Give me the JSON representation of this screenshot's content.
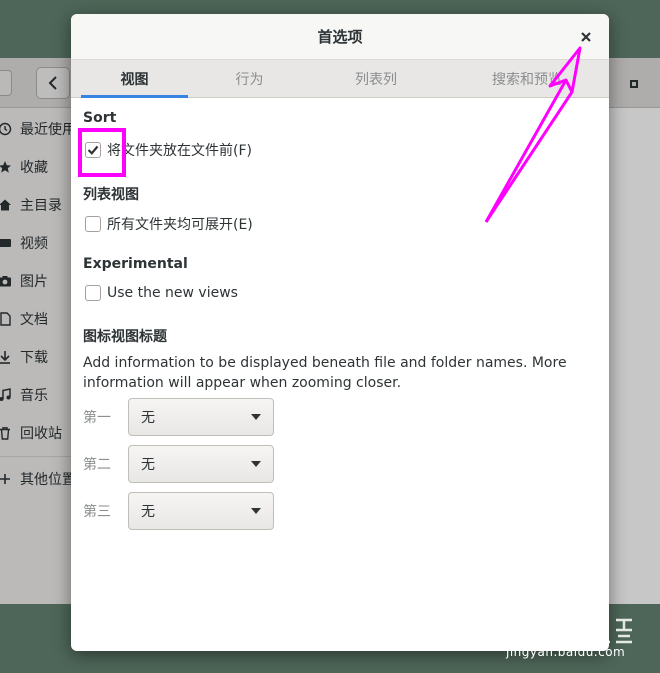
{
  "background_window": {
    "sidebar_items": [
      {
        "label": "最近使用",
        "icon": "clock-icon"
      },
      {
        "label": "收藏",
        "icon": "star-icon"
      },
      {
        "label": "主目录",
        "icon": "home-icon"
      },
      {
        "label": "视频",
        "icon": "video-icon"
      },
      {
        "label": "图片",
        "icon": "camera-icon"
      },
      {
        "label": "文档",
        "icon": "document-icon"
      },
      {
        "label": "下载",
        "icon": "download-icon"
      },
      {
        "label": "音乐",
        "icon": "music-icon"
      },
      {
        "label": "回收站",
        "icon": "trash-icon"
      },
      {
        "label": "其他位置",
        "icon": "plus-icon"
      }
    ]
  },
  "dialog": {
    "title": "首选项",
    "close_icon": "close-icon",
    "tabs": [
      {
        "label": "视图",
        "active": true
      },
      {
        "label": "行为",
        "active": false
      },
      {
        "label": "列表列",
        "active": false
      },
      {
        "label": "搜索和预览",
        "active": false
      }
    ],
    "sort": {
      "heading": "Sort",
      "folders_first_label": "将文件夹放在文件前(F)",
      "folders_first_checked": true
    },
    "list_view": {
      "heading": "列表视图",
      "expandable_label": "所有文件夹均可展开(E)",
      "expandable_checked": false
    },
    "experimental": {
      "heading": "Experimental",
      "new_views_label": "Use the new views",
      "new_views_checked": false
    },
    "icon_captions": {
      "heading": "图标视图标题",
      "description": "Add information to be displayed beneath file and folder names. More information will appear when zooming closer.",
      "rows": [
        {
          "label": "第一",
          "value": "无"
        },
        {
          "label": "第二",
          "value": "无"
        },
        {
          "label": "第三",
          "value": "无"
        }
      ]
    }
  },
  "annotation": {
    "color": "#ff00ff"
  },
  "watermark": {
    "text": "jingyan.baidu.com"
  },
  "colors": {
    "accent": "#3584e4",
    "desktop": "#4e6659"
  }
}
